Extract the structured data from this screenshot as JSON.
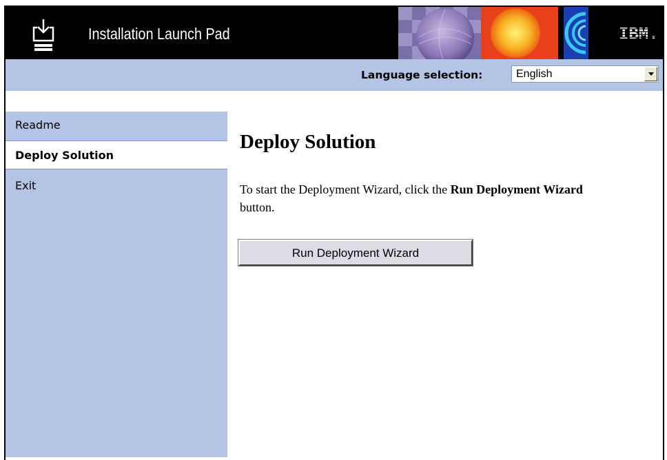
{
  "app": {
    "title": "Installation Launch Pad",
    "brand": "IBM."
  },
  "language": {
    "label": "Language selection:",
    "selected": "English"
  },
  "sidebar": {
    "items": [
      {
        "label": "Readme",
        "active": false
      },
      {
        "label": "Deploy Solution",
        "active": true
      },
      {
        "label": "Exit",
        "active": false
      }
    ]
  },
  "main": {
    "heading": "Deploy Solution",
    "description": {
      "prefix": "To start the Deployment Wizard, click the ",
      "emphasis": "Run Deployment Wizard",
      "suffix": " button."
    },
    "run_button_label": "Run Deployment Wizard"
  },
  "colors": {
    "header_bg": "#000000",
    "panel_bg": "#b4c4e4",
    "active_item_bg": "#ffffff",
    "button_bg": "#dcdce4"
  },
  "icons": {
    "app_icon": "install-download-icon",
    "dropdown_icon": "chevron-down-icon"
  }
}
